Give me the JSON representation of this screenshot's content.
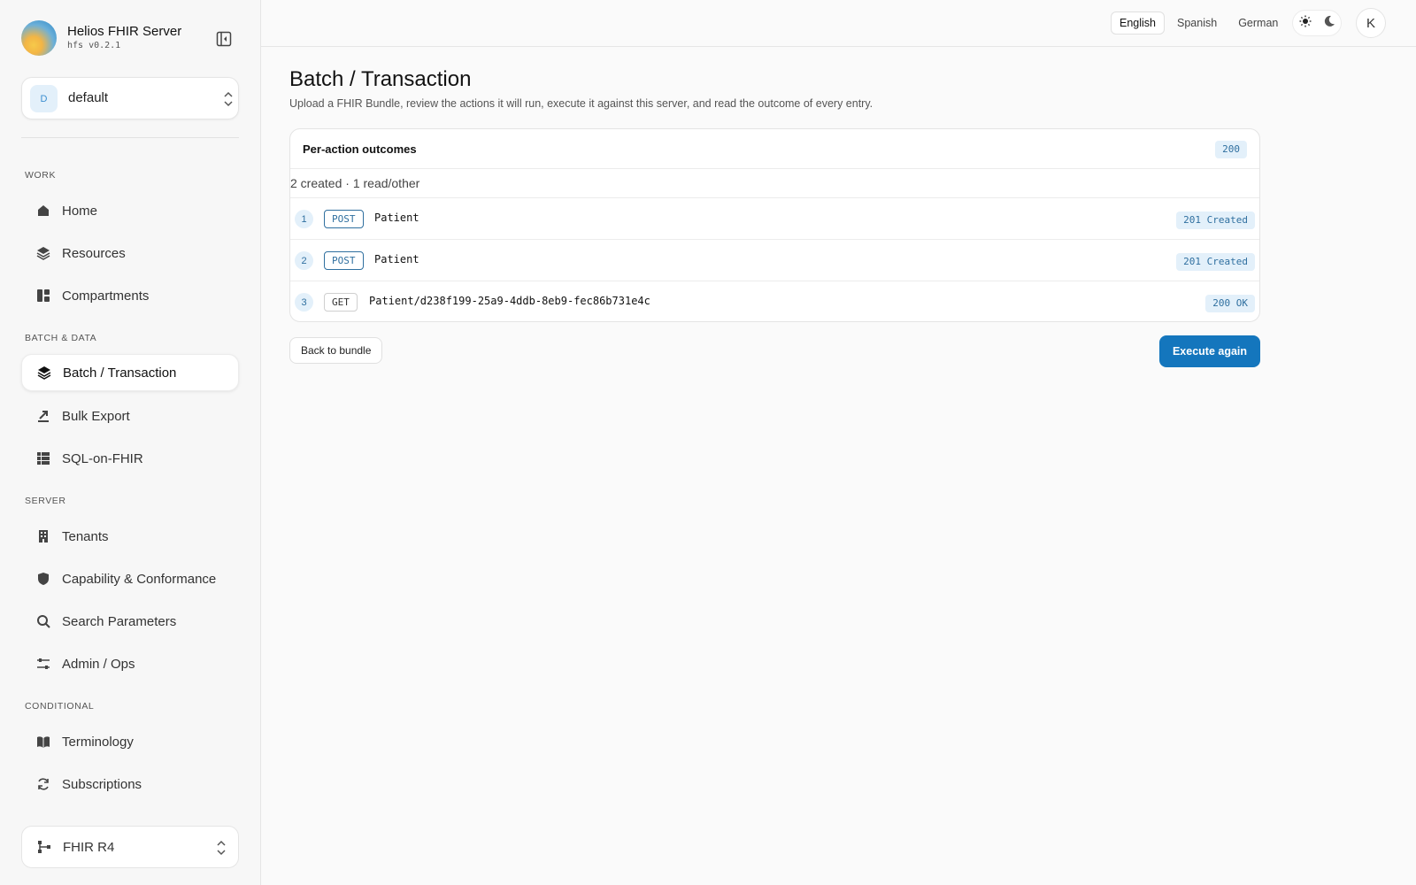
{
  "brand": {
    "title": "Helios FHIR Server",
    "version": "hfs v0.2.1"
  },
  "tenant": {
    "initial": "D",
    "name": "default"
  },
  "sidebar": {
    "sections": [
      {
        "label": "WORK"
      },
      {
        "label": "BATCH & DATA"
      },
      {
        "label": "SERVER"
      },
      {
        "label": "CONDITIONAL"
      }
    ],
    "items": [
      {
        "label": "Home",
        "icon": "home-icon"
      },
      {
        "label": "Resources",
        "icon": "layers-icon"
      },
      {
        "label": "Compartments",
        "icon": "dashboard-icon"
      },
      {
        "label": "Batch / Transaction",
        "icon": "layers-icon",
        "active": true
      },
      {
        "label": "Bulk Export",
        "icon": "export-icon"
      },
      {
        "label": "SQL-on-FHIR",
        "icon": "grid-icon"
      },
      {
        "label": "Tenants",
        "icon": "building-icon"
      },
      {
        "label": "Capability & Conformance",
        "icon": "shield-icon"
      },
      {
        "label": "Search Parameters",
        "icon": "search-icon"
      },
      {
        "label": "Admin / Ops",
        "icon": "sliders-icon"
      },
      {
        "label": "Terminology",
        "icon": "book-icon"
      },
      {
        "label": "Subscriptions",
        "icon": "refresh-icon"
      }
    ],
    "fhir_version": "FHIR R4"
  },
  "topbar": {
    "languages": [
      "English",
      "Spanish",
      "German"
    ],
    "active_language": "English",
    "user_initial": "K"
  },
  "main": {
    "title": "Batch / Transaction",
    "subtitle": "Upload a FHIR Bundle, review the actions it will run, execute it against this server, and read the outcome of every entry.",
    "outcomes": {
      "title": "Per-action outcomes",
      "status": "200",
      "summary": "2 created · 1 read/other",
      "rows": [
        {
          "num": "1",
          "method": "POST",
          "url": "Patient",
          "status": "201 Created"
        },
        {
          "num": "2",
          "method": "POST",
          "url": "Patient",
          "status": "201 Created"
        },
        {
          "num": "3",
          "method": "GET",
          "url": "Patient/d238f199-25a9-4ddb-8eb9-fec86b731e4c",
          "status": "200 OK"
        }
      ]
    },
    "back_label": "Back to bundle",
    "execute_label": "Execute again"
  },
  "colors": {
    "accent": "#1476bd",
    "badge_bg": "#e3f0fa",
    "badge_text": "#2f6f9f"
  }
}
